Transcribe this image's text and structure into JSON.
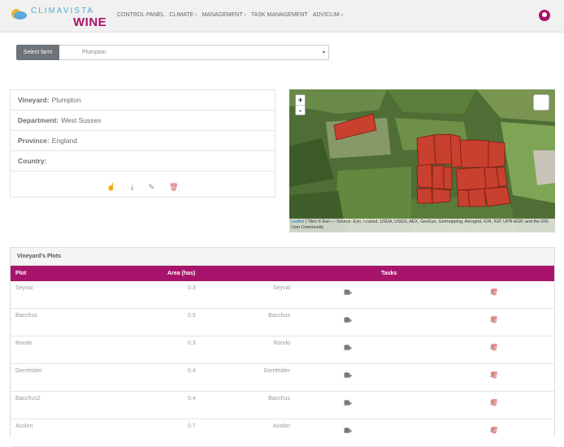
{
  "brand": {
    "top": "CLIMAVISTA",
    "bottom": "WINE",
    "color": "#a8146b",
    "accent": "#5aa9d6"
  },
  "nav": {
    "items": [
      "CONTROL PANEL",
      "CLIMATE ›",
      "MANAGEMENT ›",
      "TASK MANAGEMENT",
      "ADVICLIM ›"
    ],
    "user_icon": "user-circle-icon"
  },
  "farm": {
    "label": "Select farm",
    "value": "Plumpton",
    "caret": "▾"
  },
  "vineyard": {
    "rows": [
      {
        "label": "Vineyard:",
        "value": "Plumpton"
      },
      {
        "label": "Department:",
        "value": "West Sussex"
      },
      {
        "label": "Province:",
        "value": "England"
      },
      {
        "label": "Country:",
        "value": ""
      }
    ],
    "actions": [
      "hand-pointer-icon",
      "download-icon",
      "edit-icon",
      "trash-icon"
    ]
  },
  "map": {
    "zoom_in": "+",
    "zoom_out": "-",
    "attribution_link": "Leaflet",
    "attribution": "| Tiles © Esri — Source: Esri, i-cubed, USDA, USGS, AEX, GeoEye, Getmapping, Aerogrid, IGN, IGP, UPR-EGP, and the GIS User Community",
    "plot_color": "#c8402e"
  },
  "plots": {
    "title": "Vineyard's Plots",
    "columns": {
      "plot": "Plot",
      "area": "Area (has)",
      "tasks": "Tasks"
    },
    "rows": [
      {
        "plot": "Seyval",
        "area": "0.3",
        "variety": "Seyval"
      },
      {
        "plot": "Bacchus",
        "area": "0.5",
        "variety": "Bacchus"
      },
      {
        "plot": "Rondo",
        "area": "0.3",
        "variety": "Rondo"
      },
      {
        "plot": "Dornfelder",
        "area": "0.4",
        "variety": "Dornfelder"
      },
      {
        "plot": "Bacchus2",
        "area": "0.4",
        "variety": "Bacchus"
      },
      {
        "plot": "Acolon",
        "area": "0.7",
        "variety": "Acolon"
      }
    ],
    "task_icons": [
      "vine-icon",
      "notebook-icon",
      "tractor-icon",
      "calendar-icon"
    ],
    "row_actions": [
      "download-icon",
      "edit-icon",
      "trash-icon"
    ]
  }
}
